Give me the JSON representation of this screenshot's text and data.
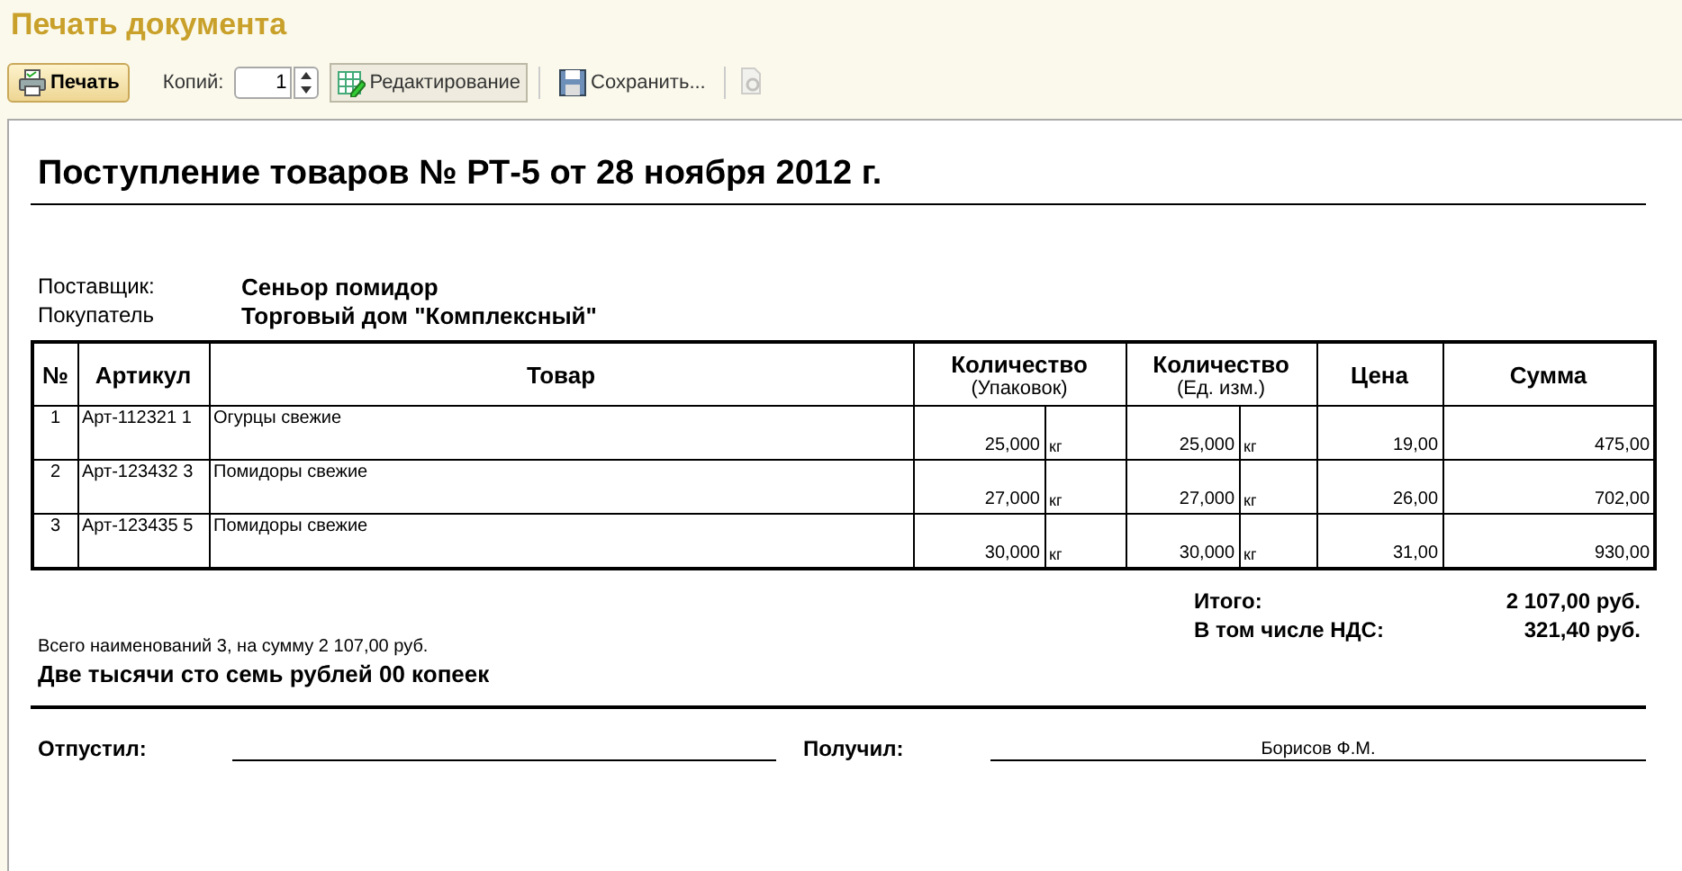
{
  "window": {
    "title": "Печать документа"
  },
  "toolbar": {
    "print_button": "Печать",
    "copies_label": "Копий:",
    "copies_value": "1",
    "edit_button": {
      "label": "Редактирование",
      "selected": true
    },
    "save_button": "Сохранить..."
  },
  "document": {
    "title": "Поступление товаров № РТ-5 от 28 ноября 2012 г.",
    "parties": [
      {
        "label": "Поставщик:",
        "value": "Сеньор помидор"
      },
      {
        "label": "Покупатель",
        "value": "Торговый дом \"Комплексный\""
      }
    ],
    "table": {
      "columns": [
        {
          "title": "№"
        },
        {
          "title": "Артикул"
        },
        {
          "title": "Товар"
        },
        {
          "title": "Количество",
          "subtitle": "(Упаковок)"
        },
        {
          "title": "Количество",
          "subtitle": "(Ед. изм.)"
        },
        {
          "title": "Цена"
        },
        {
          "title": "Сумма"
        }
      ],
      "rows": [
        {
          "no": "1",
          "article": "Арт-112321 1",
          "product": "Огурцы свежие",
          "qty_packs": "25,000",
          "unit_packs": "кг",
          "qty_units": "25,000",
          "unit": "кг",
          "price": "19,00",
          "sum": "475,00"
        },
        {
          "no": "2",
          "article": "Арт-123432 3",
          "product": "Помидоры свежие",
          "qty_packs": "27,000",
          "unit_packs": "кг",
          "qty_units": "27,000",
          "unit": "кг",
          "price": "26,00",
          "sum": "702,00"
        },
        {
          "no": "3",
          "article": "Арт-123435 5",
          "product": "Помидоры свежие",
          "qty_packs": "30,000",
          "unit_packs": "кг",
          "qty_units": "30,000",
          "unit": "кг",
          "price": "31,00",
          "sum": "930,00"
        }
      ]
    },
    "totals": [
      {
        "label": "Итого:",
        "value": "2 107,00 руб."
      },
      {
        "label": "В том числе НДС:",
        "value": "321,40 руб."
      }
    ],
    "summary": "Всего наименований 3, на сумму 2 107,00 руб.",
    "amount_in_words": "Две тысячи сто семь рублей 00 копеек",
    "signatures": [
      {
        "label": "Отпустил:"
      },
      {
        "label": "Получил:",
        "name": "Борисов Ф.М."
      }
    ]
  }
}
